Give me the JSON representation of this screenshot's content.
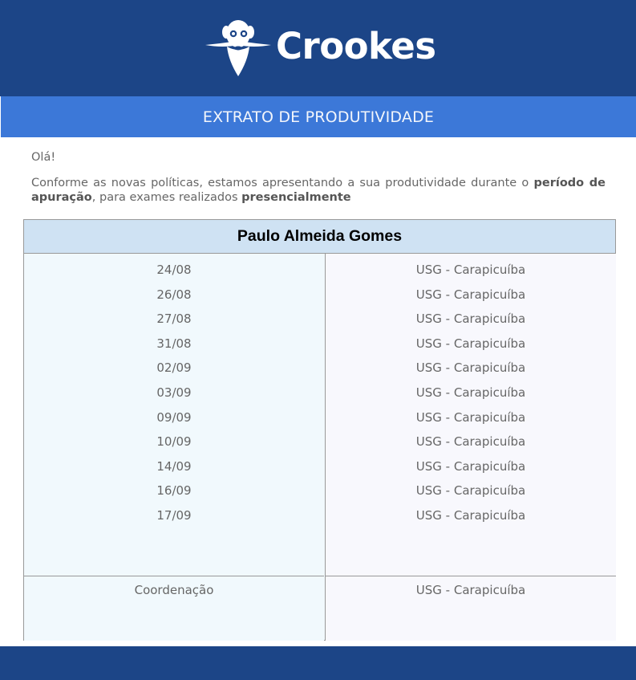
{
  "brand": {
    "name": "Crookes",
    "logo_icon": "bearded-scientist-icon"
  },
  "banner": {
    "title": "EXTRATO DE PRODUTIVIDADE"
  },
  "message": {
    "greeting": "Olá!",
    "intro_start": "Conforme as novas políticas, estamos apresentando a sua produtividade durante o ",
    "intro_bold1": "período de apuração",
    "intro_mid": ", para exames realizados ",
    "intro_bold2": "presencialmente"
  },
  "table": {
    "professional": "Paulo Almeida Gomes",
    "rows": [
      {
        "date": "24/08",
        "unit": "USG - Carapicuíba"
      },
      {
        "date": "26/08",
        "unit": "USG - Carapicuíba"
      },
      {
        "date": "27/08",
        "unit": "USG - Carapicuíba"
      },
      {
        "date": "31/08",
        "unit": "USG - Carapicuíba"
      },
      {
        "date": "02/09",
        "unit": "USG - Carapicuíba"
      },
      {
        "date": "03/09",
        "unit": "USG - Carapicuíba"
      },
      {
        "date": "09/09",
        "unit": "USG - Carapicuíba"
      },
      {
        "date": "10/09",
        "unit": "USG - Carapicuíba"
      },
      {
        "date": "14/09",
        "unit": "USG - Carapicuíba"
      },
      {
        "date": "16/09",
        "unit": "USG - Carapicuíba"
      },
      {
        "date": "17/09",
        "unit": "USG - Carapicuíba"
      }
    ],
    "footer": {
      "label": "Coordenação",
      "unit": "USG - Carapicuíba"
    }
  },
  "colors": {
    "header": "#1c4587",
    "banner": "#3c78d8",
    "name_row": "#cfe2f3"
  }
}
